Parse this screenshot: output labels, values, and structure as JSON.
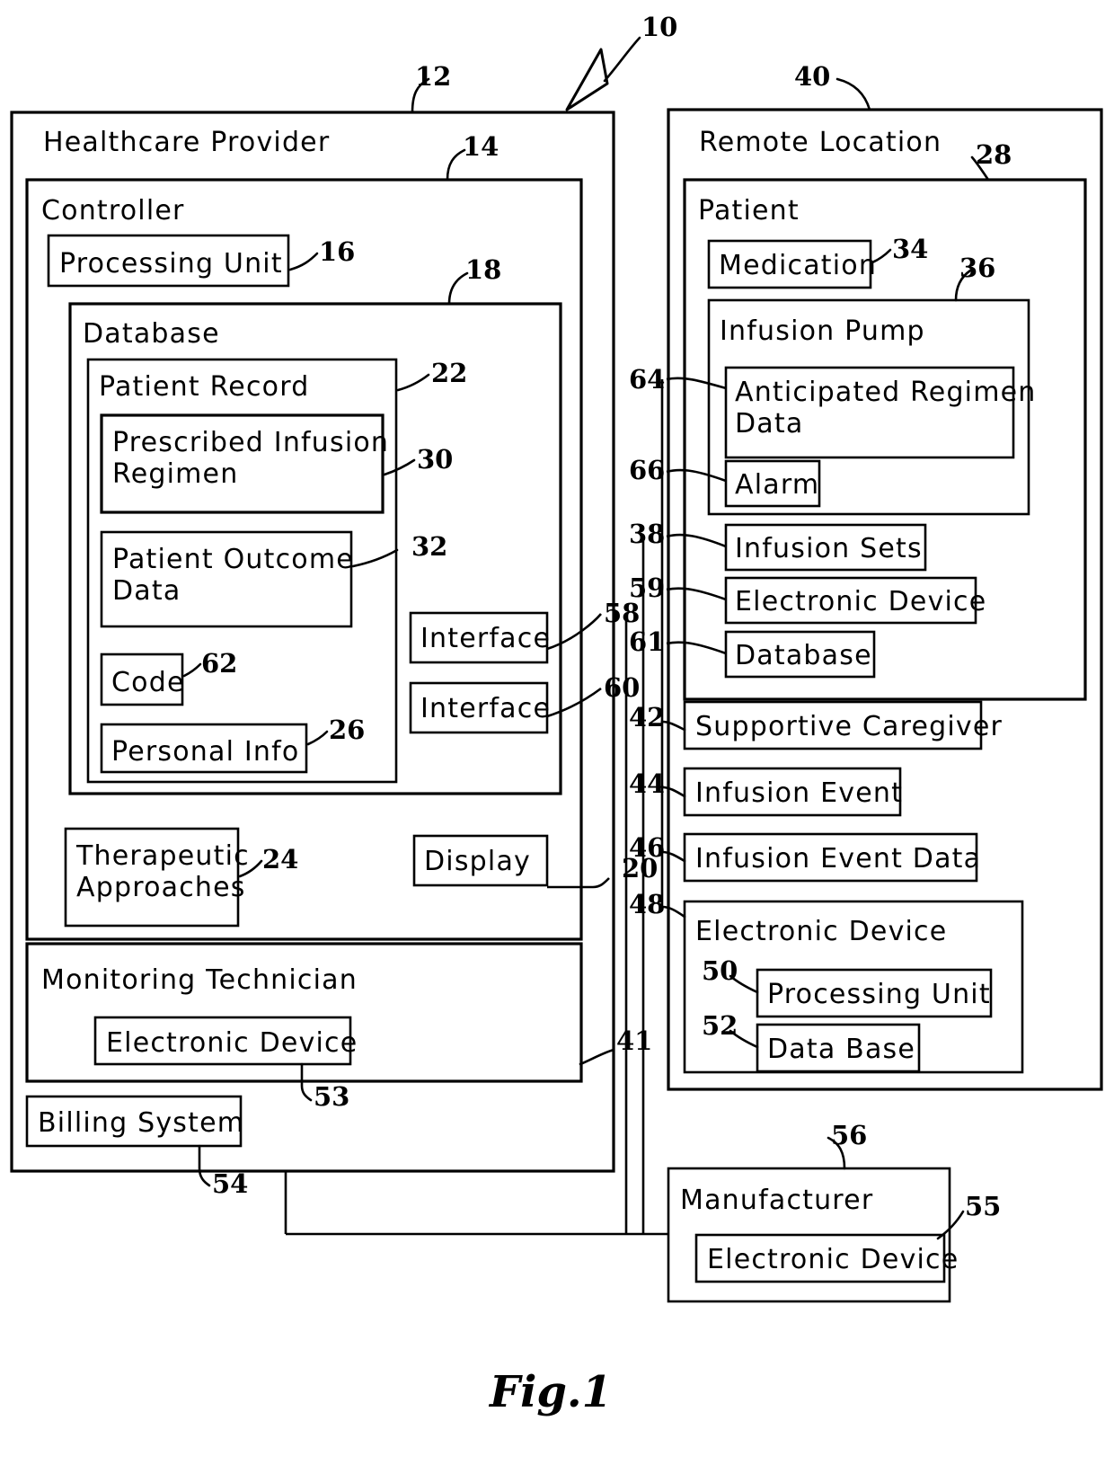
{
  "figure": {
    "caption": "Fig.1",
    "system_ref": "10"
  },
  "containers": {
    "healthcare_provider": {
      "label": "Healthcare Provider",
      "ref": "12",
      "controller": {
        "label": "Controller",
        "ref": "14",
        "processing_unit": {
          "label": "Processing Unit",
          "ref": "16"
        },
        "database": {
          "label": "Database",
          "ref": "18",
          "patient_record": {
            "label": "Patient Record",
            "ref": "22",
            "items": [
              {
                "label": "Prescribed Infusion Regimen",
                "ref": "30"
              },
              {
                "label": "Patient Outcome Data",
                "ref": "32"
              },
              {
                "label": "Code",
                "ref": "62"
              },
              {
                "label": "Personal Info",
                "ref": "26"
              }
            ]
          }
        },
        "therapeutic_approaches": {
          "label": "Therapeutic Approaches",
          "ref": "24"
        },
        "interface_top": {
          "label": "Interface",
          "ref": "58"
        },
        "interface_bottom": {
          "label": "Interface",
          "ref": "60"
        },
        "display": {
          "label": "Display",
          "ref": "20"
        }
      },
      "monitoring_technician": {
        "label": "Monitoring Technician",
        "electronic_device": {
          "label": "Electronic Device",
          "ref": "53"
        }
      },
      "billing_system": {
        "label": "Billing System",
        "ref": "54"
      },
      "link_ref": "41"
    },
    "remote_location": {
      "label": "Remote Location",
      "ref": "40",
      "patient": {
        "label": "Patient",
        "ref": "28",
        "medication": {
          "label": "Medication",
          "ref": "34"
        },
        "infusion_pump": {
          "label": "Infusion Pump",
          "ref": "36",
          "anticipated_regimen_data": {
            "label": "Anticipated Regimen Data",
            "ref": "64"
          },
          "alarm": {
            "label": "Alarm",
            "ref": "66"
          }
        },
        "infusion_sets": {
          "label": "Infusion Sets",
          "ref": "38"
        },
        "electronic_device": {
          "label": "Electronic Device",
          "ref": "59"
        },
        "database": {
          "label": "Database",
          "ref": "61"
        }
      },
      "supportive_caregiver": {
        "label": "Supportive Caregiver",
        "ref": "42"
      },
      "infusion_event": {
        "label": "Infusion Event",
        "ref": "44"
      },
      "infusion_event_data": {
        "label": "Infusion Event Data",
        "ref": "46"
      },
      "electronic_device": {
        "label": "Electronic Device",
        "ref": "48",
        "processing_unit": {
          "label": "Processing Unit",
          "ref": "50"
        },
        "data_base": {
          "label": "Data Base",
          "ref": "52"
        }
      }
    },
    "manufacturer": {
      "label": "Manufacturer",
      "ref": "56",
      "electronic_device": {
        "label": "Electronic Device",
        "ref": "55"
      }
    }
  }
}
